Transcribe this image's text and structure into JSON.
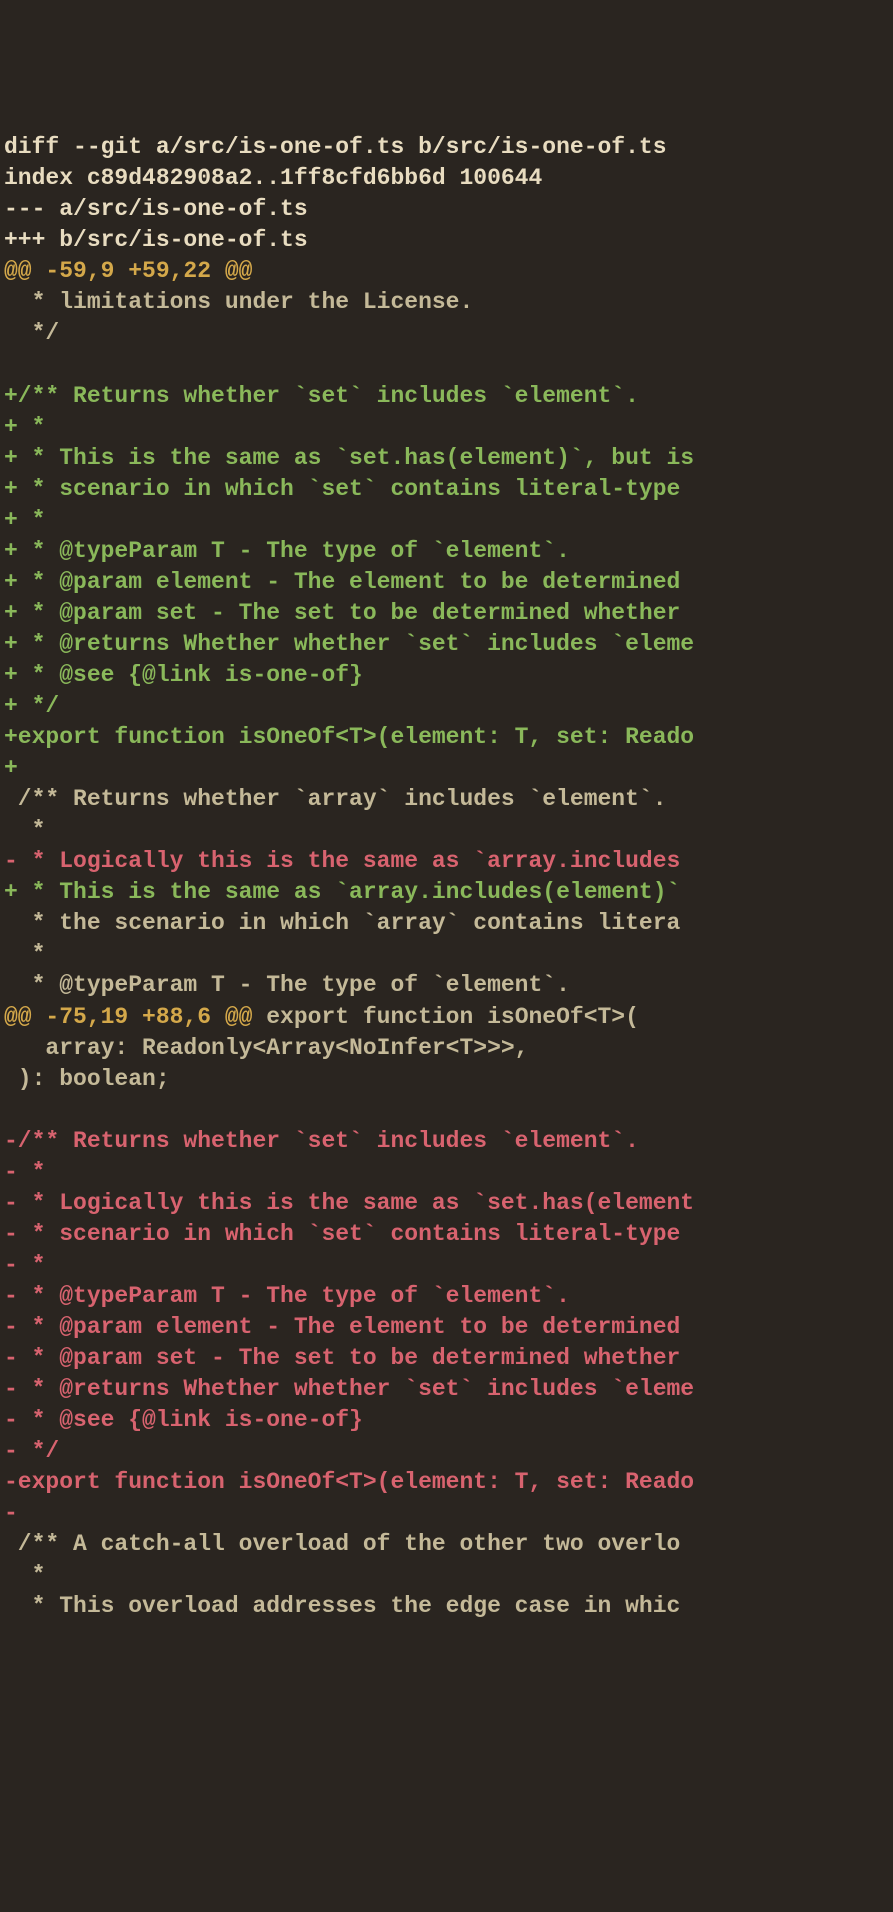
{
  "lines": [
    {
      "type": "diff-header",
      "text": "diff --git a/src/is-one-of.ts b/src/is-one-of.ts"
    },
    {
      "type": "diff-header",
      "text": "index c89d482908a2..1ff8cfd6bb6d 100644"
    },
    {
      "type": "diff-header",
      "text": "--- a/src/is-one-of.ts"
    },
    {
      "type": "diff-header",
      "text": "+++ b/src/is-one-of.ts"
    },
    {
      "type": "hunk-header",
      "text": "@@ -59,9 +59,22 @@"
    },
    {
      "type": "context",
      "text": "  * limitations under the License."
    },
    {
      "type": "context",
      "text": "  */"
    },
    {
      "type": "context",
      "text": " "
    },
    {
      "type": "added",
      "text": "+/** Returns whether `set` includes `element`."
    },
    {
      "type": "added",
      "text": "+ *"
    },
    {
      "type": "added",
      "text": "+ * This is the same as `set.has(element)`, but is"
    },
    {
      "type": "added",
      "text": "+ * scenario in which `set` contains literal-type"
    },
    {
      "type": "added",
      "text": "+ *"
    },
    {
      "type": "added",
      "text": "+ * @typeParam T - The type of `element`."
    },
    {
      "type": "added",
      "text": "+ * @param element - The element to be determined"
    },
    {
      "type": "added",
      "text": "+ * @param set - The set to be determined whether"
    },
    {
      "type": "added",
      "text": "+ * @returns Whether whether `set` includes `eleme"
    },
    {
      "type": "added",
      "text": "+ * @see {@link is-one-of}"
    },
    {
      "type": "added",
      "text": "+ */"
    },
    {
      "type": "added",
      "text": "+export function isOneOf<T>(element: T, set: Reado"
    },
    {
      "type": "added",
      "text": "+"
    },
    {
      "type": "context",
      "text": " /** Returns whether `array` includes `element`."
    },
    {
      "type": "context",
      "text": "  *"
    },
    {
      "type": "removed",
      "text": "- * Logically this is the same as `array.includes"
    },
    {
      "type": "added",
      "text": "+ * This is the same as `array.includes(element)`"
    },
    {
      "type": "context",
      "text": "  * the scenario in which `array` contains litera"
    },
    {
      "type": "context",
      "text": "  *"
    },
    {
      "type": "context",
      "text": "  * @typeParam T - The type of `element`."
    },
    {
      "type": "hunk-mixed",
      "hunk": "@@ -75,19 +88,6 @@",
      "rest": " export function isOneOf<T>("
    },
    {
      "type": "context",
      "text": "   array: Readonly<Array<NoInfer<T>>>,"
    },
    {
      "type": "context",
      "text": " ): boolean;"
    },
    {
      "type": "context",
      "text": " "
    },
    {
      "type": "removed",
      "text": "-/** Returns whether `set` includes `element`."
    },
    {
      "type": "removed",
      "text": "- *"
    },
    {
      "type": "removed",
      "text": "- * Logically this is the same as `set.has(element"
    },
    {
      "type": "removed",
      "text": "- * scenario in which `set` contains literal-type"
    },
    {
      "type": "removed",
      "text": "- *"
    },
    {
      "type": "removed",
      "text": "- * @typeParam T - The type of `element`."
    },
    {
      "type": "removed",
      "text": "- * @param element - The element to be determined"
    },
    {
      "type": "removed",
      "text": "- * @param set - The set to be determined whether"
    },
    {
      "type": "removed",
      "text": "- * @returns Whether whether `set` includes `eleme"
    },
    {
      "type": "removed",
      "text": "- * @see {@link is-one-of}"
    },
    {
      "type": "removed",
      "text": "- */"
    },
    {
      "type": "removed",
      "text": "-export function isOneOf<T>(element: T, set: Reado"
    },
    {
      "type": "removed",
      "text": "-"
    },
    {
      "type": "context",
      "text": " /** A catch-all overload of the other two overlo"
    },
    {
      "type": "context",
      "text": "  *"
    },
    {
      "type": "context",
      "text": "  * This overload addresses the edge case in whic"
    }
  ]
}
